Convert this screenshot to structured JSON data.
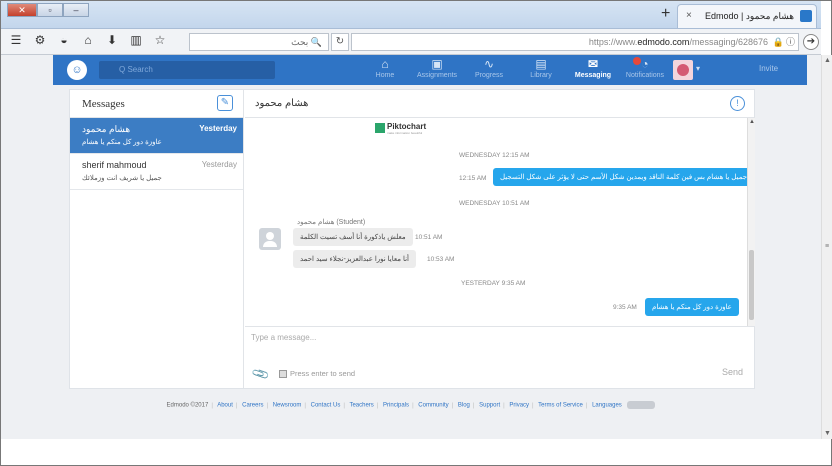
{
  "browser": {
    "tab_title": "Edmodo | هشام محمود",
    "tab_close": "×",
    "new_tab": "+",
    "search_placeholder": "بحث",
    "url_prefix": "https://www.",
    "url_domain": "edmodo.com",
    "url_path": "/messaging/628676",
    "url_lock": "🔒",
    "url_info": "ⓘ",
    "go": "➔",
    "reload": "↻"
  },
  "header": {
    "search_placeholder": "Q  Search",
    "nav": [
      {
        "label": "Home",
        "icon": "⌂"
      },
      {
        "label": "Assignments",
        "icon": "▣"
      },
      {
        "label": "Progress",
        "icon": "∿"
      },
      {
        "label": "Library",
        "icon": "▤"
      },
      {
        "label": "Messaging",
        "icon": "✉"
      },
      {
        "label": "Notifications",
        "icon": "◔"
      }
    ],
    "invite": "Invite"
  },
  "sidebar": {
    "title": "Messages",
    "conversations": [
      {
        "name": "هشام محمود",
        "date": "Yesterday",
        "snippet": "عاوزة دور كل منكم يا هشام"
      },
      {
        "name": "sherif mahmoud",
        "date": "Yesterday",
        "snippet": "جميل يا شريف انت وزملائك"
      }
    ]
  },
  "chat": {
    "title": "هشام محمود",
    "brand": "Piktochart",
    "brand_sub": "make information beautiful",
    "ts1": "WEDNESDAY 12:15 AM",
    "msg1": "جميل يا هشام بس فين كلمة الناقد ويمدين شكل الأسم حتى لا يؤثر على شكل التسجيل",
    "msg1_time": "12:15 AM",
    "ts2": "WEDNESDAY 10:51 AM",
    "sender": "هشام محمود (Student)",
    "msg2": "معلش ياذكورة أنا أسف تسيت الكلمة",
    "msg2_time": "10:51 AM",
    "msg3": "أنا معايا نورا عبدالعزيز-نجلاء سيد احمد",
    "msg3_time": "10:53 AM",
    "ts3": "YESTERDAY 9:35 AM",
    "msg4": "عاوزة دور كل منكم يا هشام",
    "msg4_time": "9:35 AM",
    "composer_placeholder": "Type a message...",
    "enter_label": "Press enter to send",
    "send": "Send"
  },
  "footer": {
    "copyright": "Edmodo ©2017",
    "links": [
      "About",
      "Careers",
      "Newsroom",
      "Contact Us",
      "Teachers",
      "Principals",
      "Community",
      "Blog",
      "Support",
      "Privacy",
      "Terms of Service",
      "Languages"
    ]
  }
}
